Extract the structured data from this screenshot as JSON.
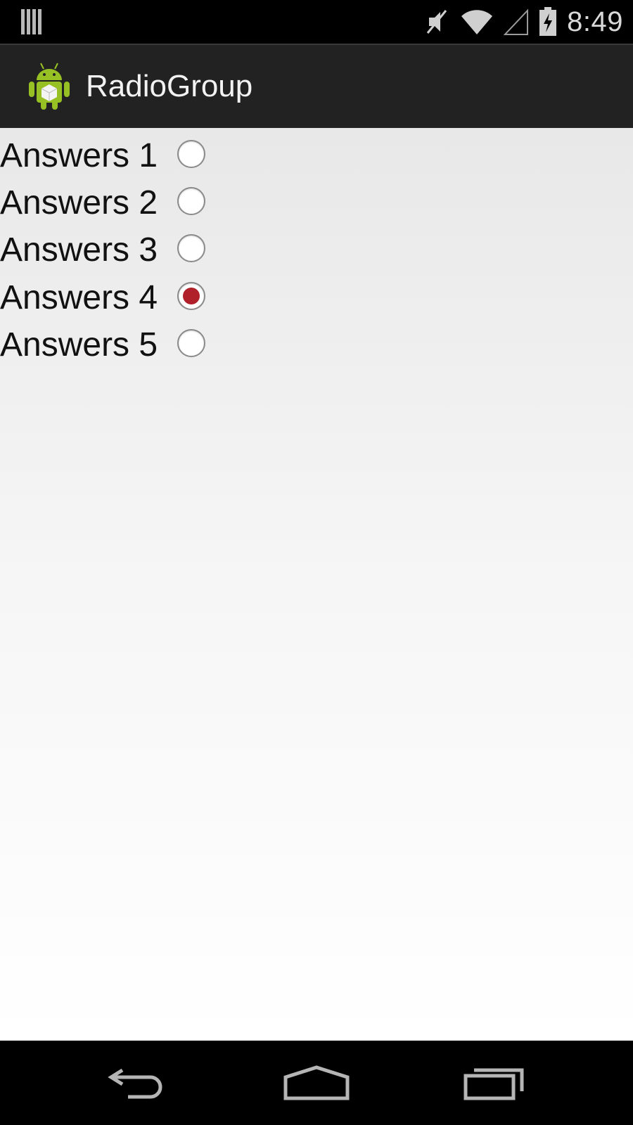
{
  "status_bar": {
    "clock": "8:49",
    "icons": [
      "signal-bars-icon",
      "mute-icon",
      "wifi-icon",
      "cell-signal-icon",
      "battery-charging-icon"
    ]
  },
  "action_bar": {
    "title": "RadioGroup",
    "app_icon": "android-icon"
  },
  "radio_group": {
    "items": [
      {
        "label": "Answers 1",
        "checked": false
      },
      {
        "label": "Answers 2",
        "checked": false
      },
      {
        "label": "Answers 3",
        "checked": false
      },
      {
        "label": "Answers 4",
        "checked": true
      },
      {
        "label": "Answers 5",
        "checked": false
      }
    ],
    "accent_color": "#b0202a"
  },
  "nav_bar": {
    "buttons": [
      "back-icon",
      "home-icon",
      "recent-apps-icon"
    ]
  }
}
